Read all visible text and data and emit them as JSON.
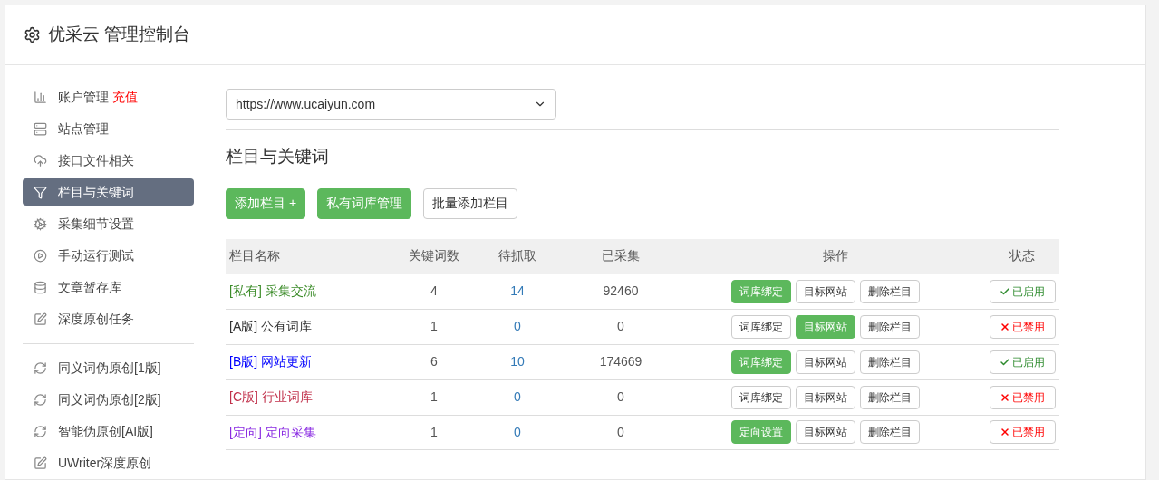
{
  "header": {
    "title": "优采云 管理控制台"
  },
  "sidebar": {
    "groups": [
      [
        {
          "label": "账户管理",
          "badge": "充值",
          "selected": false
        },
        {
          "label": "站点管理",
          "selected": false
        },
        {
          "label": "接口文件相关",
          "selected": false
        },
        {
          "label": "栏目与关键词",
          "selected": true
        },
        {
          "label": "采集细节设置",
          "selected": false
        },
        {
          "label": "手动运行测试",
          "selected": false
        },
        {
          "label": "文章暂存库",
          "selected": false
        },
        {
          "label": "深度原创任务",
          "selected": false
        }
      ],
      [
        {
          "label": "同义词伪原创[1版]",
          "selected": false
        },
        {
          "label": "同义词伪原创[2版]",
          "selected": false
        },
        {
          "label": "智能伪原创[AI版]",
          "selected": false
        },
        {
          "label": "UWriter深度原创",
          "selected": false
        }
      ]
    ]
  },
  "site_select": {
    "value": "https://www.ucaiyun.com"
  },
  "section_title": "栏目与关键词",
  "actions": [
    {
      "label": "添加栏目 +",
      "primary": true
    },
    {
      "label": "私有词库管理",
      "primary": true
    },
    {
      "label": "批量添加栏目",
      "primary": false
    }
  ],
  "table": {
    "columns": [
      "栏目名称",
      "关键词数",
      "待抓取",
      "已采集",
      "操作",
      "状态"
    ],
    "rows": [
      {
        "tag": "[私有]",
        "name": "采集交流",
        "color": "#3c8c2a",
        "keywords": "4",
        "pending": "14",
        "collected": "92460",
        "ops": [
          {
            "label": "词库绑定",
            "primary": true
          },
          {
            "label": "目标网站",
            "primary": false
          },
          {
            "label": "删除栏目",
            "primary": false
          }
        ],
        "enabled": true,
        "status": "已启用"
      },
      {
        "tag": "[A版]",
        "name": "公有词库",
        "color": "#333333",
        "keywords": "1",
        "pending": "0",
        "collected": "0",
        "ops": [
          {
            "label": "词库绑定",
            "primary": false
          },
          {
            "label": "目标网站",
            "primary": true
          },
          {
            "label": "删除栏目",
            "primary": false
          }
        ],
        "enabled": false,
        "status": "已禁用"
      },
      {
        "tag": "[B版]",
        "name": "网站更新",
        "color": "#0000ff",
        "keywords": "6",
        "pending": "10",
        "collected": "174669",
        "ops": [
          {
            "label": "词库绑定",
            "primary": true
          },
          {
            "label": "目标网站",
            "primary": false
          },
          {
            "label": "删除栏目",
            "primary": false
          }
        ],
        "enabled": true,
        "status": "已启用"
      },
      {
        "tag": "[C版]",
        "name": "行业词库",
        "color": "#c0304a",
        "keywords": "1",
        "pending": "0",
        "collected": "0",
        "ops": [
          {
            "label": "词库绑定",
            "primary": false
          },
          {
            "label": "目标网站",
            "primary": false
          },
          {
            "label": "删除栏目",
            "primary": false
          }
        ],
        "enabled": false,
        "status": "已禁用"
      },
      {
        "tag": "[定向]",
        "name": "定向采集",
        "color": "#8a2be2",
        "keywords": "1",
        "pending": "0",
        "collected": "0",
        "ops": [
          {
            "label": "定向设置",
            "primary": true
          },
          {
            "label": "目标网站",
            "primary": false
          },
          {
            "label": "删除栏目",
            "primary": false
          }
        ],
        "enabled": false,
        "status": "已禁用"
      }
    ]
  }
}
